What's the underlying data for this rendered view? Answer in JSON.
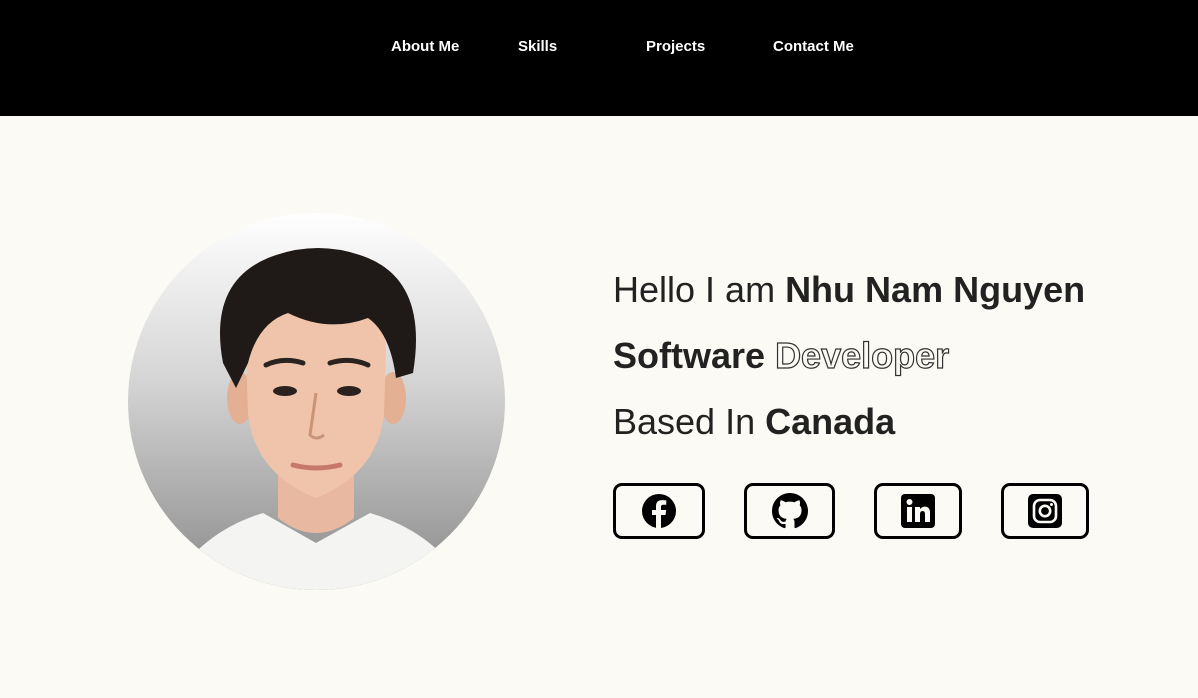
{
  "nav": {
    "about": "About Me",
    "skills": "Skills",
    "projects": "Projects",
    "contact": "Contact Me"
  },
  "hero": {
    "greeting_prefix": "Hello I am ",
    "name": "Nhu Nam Nguyen",
    "role_bold": "Software",
    "role_outline": "Developer",
    "location_prefix": "Based In ",
    "location": "Canada"
  },
  "social": [
    {
      "icon": "facebook-icon"
    },
    {
      "icon": "github-icon"
    },
    {
      "icon": "linkedin-icon"
    },
    {
      "icon": "instagram-icon"
    }
  ],
  "colors": {
    "header_bg": "#000000",
    "page_bg": "#fbfaf4",
    "text": "#222222",
    "nav_text": "#ffffff"
  }
}
